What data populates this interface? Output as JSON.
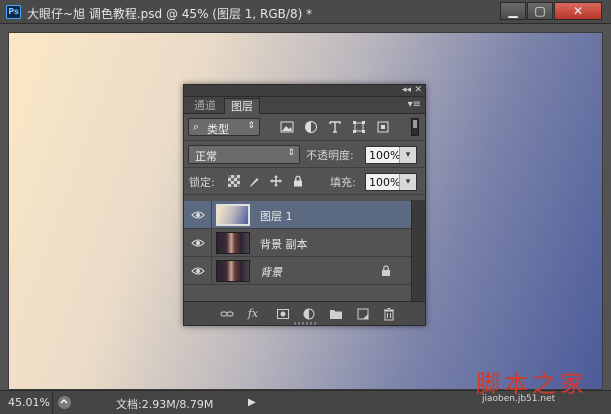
{
  "window": {
    "app_icon": "Ps",
    "title": "大眼仔~旭 调色教程.psd @ 45% (图层 1, RGB/8) *",
    "btn_minimize": "▁",
    "btn_maximize": "▢",
    "btn_close": "✕"
  },
  "panel": {
    "collapse": "◂◂",
    "close": "✕",
    "tabs": [
      {
        "label": "通道",
        "active": false
      },
      {
        "label": "图层",
        "active": true
      }
    ],
    "menu": "▾≡",
    "filter": {
      "icon": "⌕",
      "label": "类型",
      "arrow": "⇕"
    },
    "filter_icons": [
      "image-icon",
      "adjustment-icon",
      "type-icon",
      "shape-icon",
      "smart-object-icon"
    ],
    "blend_mode": {
      "value": "正常",
      "arrow": "⇕"
    },
    "opacity": {
      "label": "不透明度:",
      "value": "100%",
      "arrow": "▾"
    },
    "lock": {
      "label": "锁定:"
    },
    "fill": {
      "label": "填充:",
      "value": "100%",
      "arrow": "▾"
    },
    "layers": [
      {
        "name": "图层 1",
        "selected": true,
        "italic": false,
        "locked": false,
        "thumb": "gradient"
      },
      {
        "name": "背景 副本",
        "selected": false,
        "italic": false,
        "locked": false,
        "thumb": "photo"
      },
      {
        "name": "背景",
        "selected": false,
        "italic": true,
        "locked": true,
        "thumb": "photo"
      }
    ],
    "bottom_icons": [
      "link-icon",
      "fx-icon",
      "mask-icon",
      "adjustment-layer-icon",
      "group-folder-icon",
      "new-layer-icon",
      "trash-icon"
    ],
    "fx_label": "fx"
  },
  "status": {
    "zoom": "45.01%",
    "doc_info": "文档:2.93M/8.79M",
    "play": "▶"
  },
  "watermark": {
    "main": "脚本之家",
    "sub": "jiaoben.jb51.net"
  },
  "colors": {
    "selected_layer": "#5b6a80",
    "canvas_start": "#fbe8c6",
    "canvas_end": "#4b5a9a",
    "watermark": "#d23a2a"
  }
}
